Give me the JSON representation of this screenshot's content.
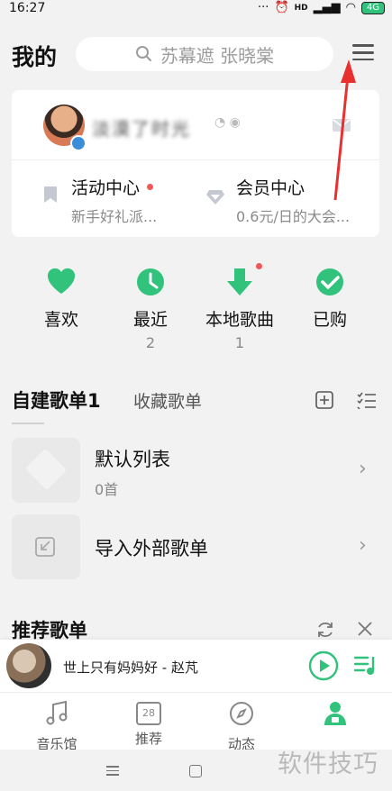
{
  "status_bar": {
    "time": "16:27",
    "signal": "HD",
    "battery": "4G"
  },
  "header": {
    "title": "我的",
    "search_placeholder": "苏幕遮 张晓棠"
  },
  "profile": {
    "username": "淡漠了时光",
    "mail_icon": "mail-icon",
    "links": [
      {
        "title": "活动中心",
        "subtitle": "新手好礼派...",
        "icon": "bookmark-icon",
        "has_dot": true
      },
      {
        "title": "会员中心",
        "subtitle": "0.6元/日的大会...",
        "icon": "diamond-icon",
        "has_dot": false
      }
    ]
  },
  "quick_entries": [
    {
      "label": "喜欢",
      "count": "",
      "icon": "heart-icon"
    },
    {
      "label": "最近",
      "count": "2",
      "icon": "clock-icon"
    },
    {
      "label": "本地歌曲",
      "count": "1",
      "icon": "download-icon"
    },
    {
      "label": "已购",
      "count": "",
      "icon": "check-icon"
    }
  ],
  "playlist_tabs": {
    "active": "自建歌单1",
    "inactive": "收藏歌单"
  },
  "playlists": [
    {
      "title": "默认列表",
      "subtitle": "0首"
    },
    {
      "title": "导入外部歌单",
      "subtitle": ""
    }
  ],
  "recommend": {
    "title": "推荐歌单"
  },
  "mini_player": {
    "track": "世上只有妈妈好 - 赵芃"
  },
  "bottom_nav": [
    {
      "label": "音乐馆",
      "icon": "music-note-icon"
    },
    {
      "label": "推荐",
      "icon": "calendar-icon",
      "day": "28"
    },
    {
      "label": "动态",
      "icon": "compass-icon"
    },
    {
      "label": "",
      "icon": "user-icon"
    }
  ],
  "watermark": "软件技巧",
  "colors": {
    "accent": "#31c27c",
    "dot": "#f25757",
    "arrow": "#e8312f"
  }
}
